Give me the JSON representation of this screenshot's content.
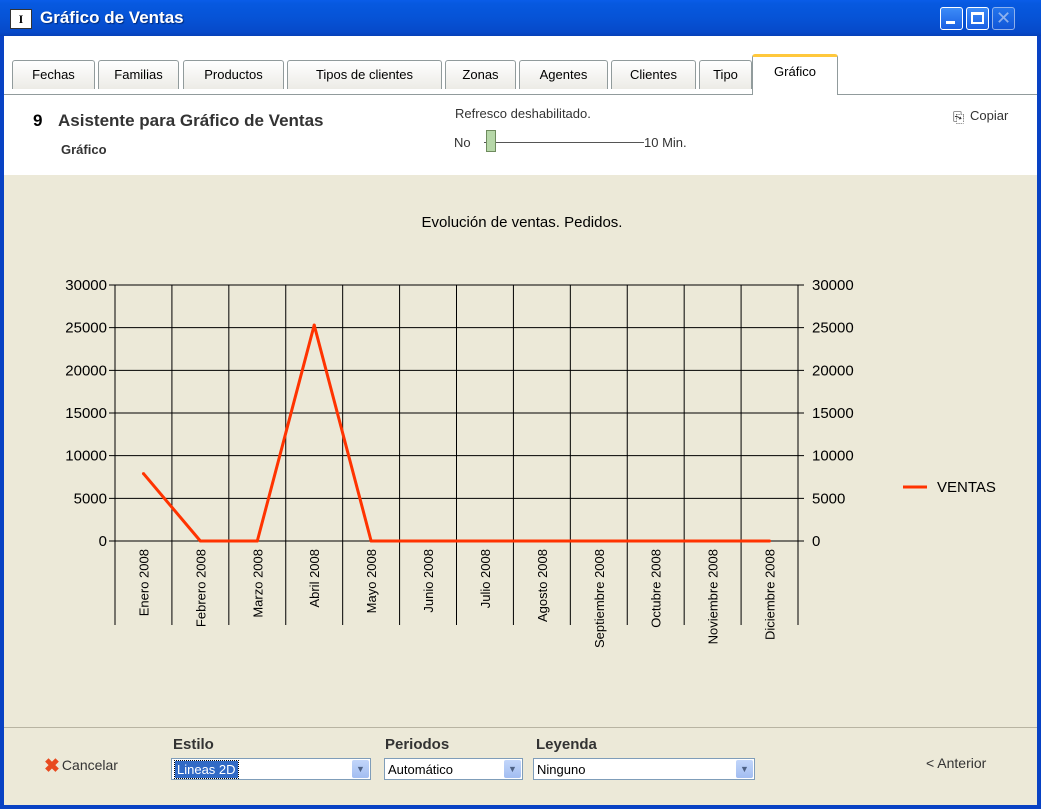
{
  "window": {
    "title": "Gráfico de Ventas",
    "icon_label": "I5.0"
  },
  "tabs": [
    {
      "label": "Fechas"
    },
    {
      "label": "Familias"
    },
    {
      "label": "Productos"
    },
    {
      "label": "Tipos de clientes"
    },
    {
      "label": "Zonas"
    },
    {
      "label": "Agentes"
    },
    {
      "label": "Clientes"
    },
    {
      "label": "Tipo"
    },
    {
      "label": "Gráfico",
      "active": true
    }
  ],
  "header": {
    "step_number": "9",
    "step_title": "Asistente para Gráfico de Ventas",
    "step_subtitle": "Gráfico",
    "refresh_label": "Refresco deshabilitado.",
    "slider_min_label": "No",
    "slider_max_label": "10 Min.",
    "copy_label": "Copiar"
  },
  "chart_data": {
    "type": "line",
    "title": "Evolución de ventas. Pedidos.",
    "categories": [
      "Enero 2008",
      "Febrero 2008",
      "Marzo 2008",
      "Abril 2008",
      "Mayo 2008",
      "Junio 2008",
      "Julio 2008",
      "Agosto 2008",
      "Septiembre 2008",
      "Octubre 2008",
      "Noviembre 2008",
      "Diciembre 2008"
    ],
    "series": [
      {
        "name": "VENTAS",
        "color": "#FF3300",
        "values": [
          7900,
          0,
          0,
          25300,
          0,
          0,
          0,
          0,
          0,
          0,
          0,
          0
        ]
      }
    ],
    "ylim": [
      0,
      30000
    ],
    "yticks": [
      "0",
      "5000",
      "10000",
      "15000",
      "20000",
      "25000",
      "30000"
    ],
    "grid": true,
    "legend": "right"
  },
  "footer": {
    "cancel_label": "Cancelar",
    "estilo_label": "Estilo",
    "estilo_value": "Lineas 2D",
    "periodos_label": "Periodos",
    "periodos_value": "Automático",
    "leyenda_label": "Leyenda",
    "leyenda_value": "Ninguno",
    "prev_label": "< Anterior"
  }
}
